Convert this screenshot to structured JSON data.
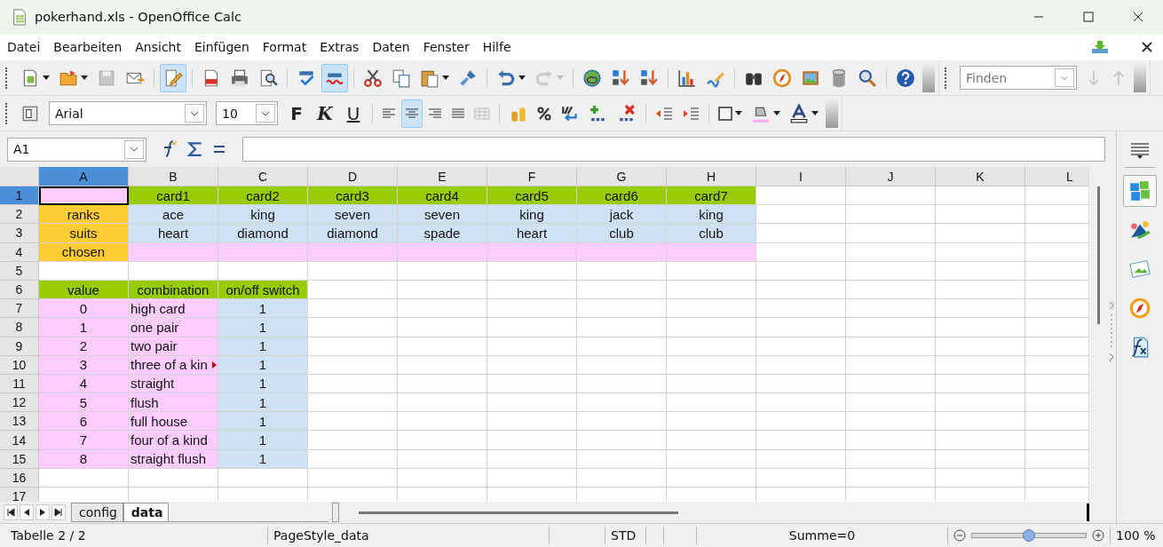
{
  "window": {
    "title": "pokerhand.xls - OpenOffice Calc"
  },
  "menu": [
    "Datei",
    "Bearbeiten",
    "Ansicht",
    "Einfügen",
    "Format",
    "Extras",
    "Daten",
    "Fenster",
    "Hilfe"
  ],
  "standard_toolbar": {
    "edit_file_on": true,
    "autospell_on": true
  },
  "find_toolbar": {
    "placeholder": "Finden"
  },
  "formatting_toolbar": {
    "font": "Arial",
    "size": "10",
    "styles": [
      "F",
      "K",
      "U"
    ],
    "alignments": [
      {
        "selected": false
      },
      {
        "selected": true
      },
      {
        "selected": false
      },
      {
        "selected": false
      }
    ]
  },
  "formula_bar": {
    "cell_reference": "A1"
  },
  "columns": [
    {
      "label": "A",
      "selected": true
    },
    {
      "label": "B",
      "selected": false
    },
    {
      "label": "C",
      "selected": false
    },
    {
      "label": "D",
      "selected": false
    },
    {
      "label": "E",
      "selected": false
    },
    {
      "label": "F",
      "selected": false
    },
    {
      "label": "G",
      "selected": false
    },
    {
      "label": "H",
      "selected": false
    },
    {
      "label": "I",
      "selected": false
    },
    {
      "label": "J",
      "selected": false
    },
    {
      "label": "K",
      "selected": false
    },
    {
      "label": "L",
      "selected": false
    }
  ],
  "rows": [
    {
      "label": "1",
      "selected": true,
      "cells": [
        {
          "color": "#ffccff"
        },
        {
          "text": "card1",
          "color": "#99cc00"
        },
        {
          "text": "card2",
          "color": "#99cc00"
        },
        {
          "text": "card3",
          "color": "#99cc00"
        },
        {
          "text": "card4",
          "color": "#99cc00"
        },
        {
          "text": "card5",
          "color": "#99cc00"
        },
        {
          "text": "card6",
          "color": "#99cc00"
        },
        {
          "text": "card7",
          "color": "#99cc00"
        }
      ]
    },
    {
      "label": "2",
      "selected": false,
      "cells": [
        {
          "text": "ranks",
          "color": "#ffcc33"
        },
        {
          "text": "ace",
          "color": "#cfe2f3"
        },
        {
          "text": "king",
          "color": "#cfe2f3"
        },
        {
          "text": "seven",
          "color": "#cfe2f3"
        },
        {
          "text": "seven",
          "color": "#cfe2f3"
        },
        {
          "text": "king",
          "color": "#cfe2f3"
        },
        {
          "text": "jack",
          "color": "#cfe2f3"
        },
        {
          "text": "king",
          "color": "#cfe2f3"
        }
      ]
    },
    {
      "label": "3",
      "selected": false,
      "cells": [
        {
          "text": "suits",
          "color": "#ffcc33"
        },
        {
          "text": "heart",
          "color": "#cfe2f3"
        },
        {
          "text": "diamond",
          "color": "#cfe2f3"
        },
        {
          "text": "diamond",
          "color": "#cfe2f3"
        },
        {
          "text": "spade",
          "color": "#cfe2f3"
        },
        {
          "text": "heart",
          "color": "#cfe2f3"
        },
        {
          "text": "club",
          "color": "#cfe2f3"
        },
        {
          "text": "club",
          "color": "#cfe2f3"
        }
      ]
    },
    {
      "label": "4",
      "selected": false,
      "cells": [
        {
          "text": "chosen",
          "color": "#ffcc33"
        },
        {
          "color": "#ffccff"
        },
        {
          "color": "#ffccff"
        },
        {
          "color": "#ffccff"
        },
        {
          "color": "#ffccff"
        },
        {
          "color": "#ffccff"
        },
        {
          "color": "#ffccff"
        },
        {
          "color": "#ffccff"
        }
      ]
    },
    {
      "label": "5",
      "selected": false,
      "cells": []
    },
    {
      "label": "6",
      "selected": false,
      "cells": [
        {
          "text": "value",
          "color": "#99cc00"
        },
        {
          "text": "combination",
          "color": "#99cc00"
        },
        {
          "text": "on/off switch",
          "color": "#99cc00"
        }
      ]
    },
    {
      "label": "7",
      "selected": false,
      "cells": [
        {
          "text": "0",
          "color": "#ffccff"
        },
        {
          "text": "high card",
          "color": "#ffccff",
          "kind": "label"
        },
        {
          "text": "1",
          "color": "#cfe2f3"
        }
      ]
    },
    {
      "label": "8",
      "selected": false,
      "cells": [
        {
          "text": "1",
          "color": "#ffccff"
        },
        {
          "text": "one pair",
          "color": "#ffccff",
          "kind": "label"
        },
        {
          "text": "1",
          "color": "#cfe2f3"
        }
      ]
    },
    {
      "label": "9",
      "selected": false,
      "cells": [
        {
          "text": "2",
          "color": "#ffccff"
        },
        {
          "text": "two pair",
          "color": "#ffccff",
          "kind": "label"
        },
        {
          "text": "1",
          "color": "#cfe2f3"
        }
      ]
    },
    {
      "label": "10",
      "selected": false,
      "cells": [
        {
          "text": "3",
          "color": "#ffccff"
        },
        {
          "text": "three of a kin",
          "color": "#ffccff",
          "kind": "label",
          "overflow": true
        },
        {
          "text": "1",
          "color": "#cfe2f3"
        }
      ]
    },
    {
      "label": "11",
      "selected": false,
      "cells": [
        {
          "text": "4",
          "color": "#ffccff"
        },
        {
          "text": "straight",
          "color": "#ffccff",
          "kind": "label"
        },
        {
          "text": "1",
          "color": "#cfe2f3"
        }
      ]
    },
    {
      "label": "12",
      "selected": false,
      "cells": [
        {
          "text": "5",
          "color": "#ffccff"
        },
        {
          "text": "flush",
          "color": "#ffccff",
          "kind": "label"
        },
        {
          "text": "1",
          "color": "#cfe2f3"
        }
      ]
    },
    {
      "label": "13",
      "selected": false,
      "cells": [
        {
          "text": "6",
          "color": "#ffccff"
        },
        {
          "text": "full house",
          "color": "#ffccff",
          "kind": "label"
        },
        {
          "text": "1",
          "color": "#cfe2f3"
        }
      ]
    },
    {
      "label": "14",
      "selected": false,
      "cells": [
        {
          "text": "7",
          "color": "#ffccff"
        },
        {
          "text": "four of a kind",
          "color": "#ffccff",
          "kind": "label"
        },
        {
          "text": "1",
          "color": "#cfe2f3"
        }
      ]
    },
    {
      "label": "15",
      "selected": false,
      "cells": [
        {
          "text": "8",
          "color": "#ffccff"
        },
        {
          "text": "straight flush",
          "color": "#ffccff",
          "kind": "label"
        },
        {
          "text": "1",
          "color": "#cfe2f3"
        }
      ]
    },
    {
      "label": "16",
      "selected": false,
      "cells": []
    },
    {
      "label": "17",
      "selected": false,
      "cells": []
    }
  ],
  "sheet_tabs": [
    {
      "label": "config",
      "selected": false
    },
    {
      "label": "data",
      "selected": true
    }
  ],
  "sidebar": [
    {
      "selected": true
    },
    {
      "selected": false
    },
    {
      "selected": false
    },
    {
      "selected": false
    },
    {
      "selected": false
    }
  ],
  "status_bar": {
    "sheet": "Tabelle 2 / 2",
    "page_style": "PageStyle_data",
    "selection_mode": "STD",
    "sum": "Summe=0",
    "zoom": {
      "level": 0.49
    },
    "zoom_reading": "100 %"
  }
}
